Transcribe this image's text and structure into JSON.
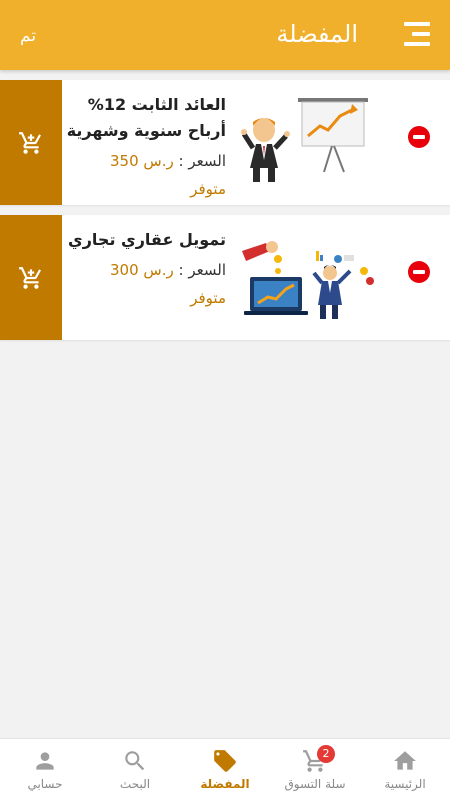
{
  "header": {
    "title": "المفضلة",
    "done_label": "تم"
  },
  "items": [
    {
      "name_line1": "العائد الثابت 12%",
      "name_line2": "أرباح سنوية وشهرية",
      "price_label": "السعر :",
      "price_value": "ر.س 350",
      "stock": "متوفر"
    },
    {
      "name_line1": "تمويل عقاري تجاري",
      "price_label": "السعر :",
      "price_value": "ر.س 300",
      "stock": "متوفر"
    }
  ],
  "nav": {
    "home": "الرئيسية",
    "cart": "سلة التسوق",
    "cart_badge": "2",
    "favorites": "المفضلة",
    "search": "البحث",
    "account": "حسابي"
  },
  "colors": {
    "header": "#f0b02c",
    "accent": "#c07a00",
    "remove": "#e8000b"
  }
}
